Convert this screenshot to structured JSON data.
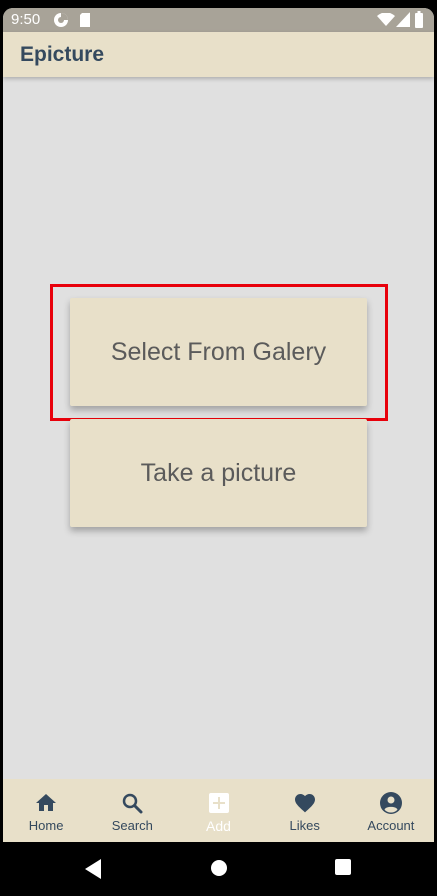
{
  "status_bar": {
    "time": "9:50",
    "icons": [
      "data-saver-icon",
      "sd-card-icon",
      "wifi-icon",
      "signal-icon",
      "battery-icon"
    ]
  },
  "app_bar": {
    "title": "Epicture"
  },
  "actions": {
    "gallery_label": "Select From Galery",
    "camera_label": "Take a picture"
  },
  "bottom_nav": {
    "items": [
      {
        "label": "Home",
        "icon": "home-icon",
        "active": false
      },
      {
        "label": "Search",
        "icon": "search-icon",
        "active": false
      },
      {
        "label": "Add",
        "icon": "add-box-icon",
        "active": true
      },
      {
        "label": "Likes",
        "icon": "heart-icon",
        "active": false
      },
      {
        "label": "Account",
        "icon": "account-circle-icon",
        "active": false
      }
    ]
  },
  "android_nav": {
    "icons": [
      "back-icon",
      "home-circle-icon",
      "recents-icon"
    ]
  },
  "colors": {
    "app_bar_bg": "#e8e0c9",
    "page_bg": "#e0e0e0",
    "title_text": "#34495e",
    "card_text": "#5b5b5b",
    "highlight": "#e8000b",
    "active_nav": "#ffffff"
  }
}
